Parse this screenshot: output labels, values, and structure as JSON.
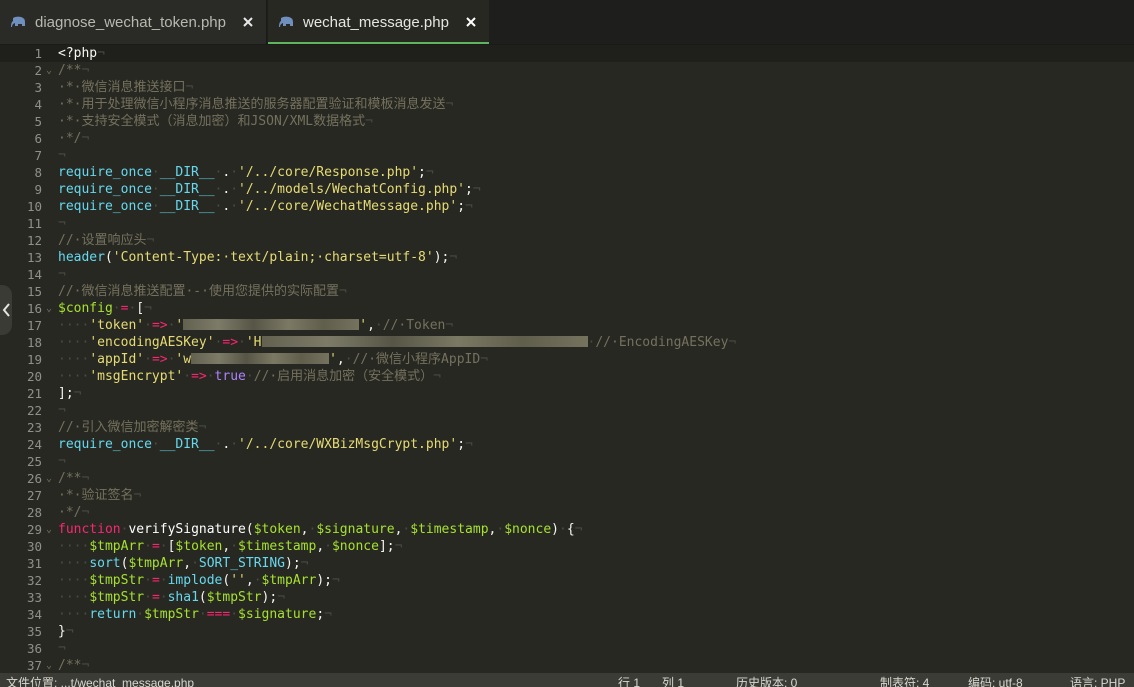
{
  "tabs": [
    {
      "label": "diagnose_wechat_token.php",
      "icon": "php-elephant-icon",
      "active": false
    },
    {
      "label": "wechat_message.php",
      "icon": "php-elephant-icon",
      "active": true
    }
  ],
  "editor": {
    "lines": [
      {
        "n": "1",
        "fold": "",
        "segs": [
          {
            "c": "tx",
            "t": "<?php"
          },
          {
            "c": "ws",
            "t": "¬"
          }
        ]
      },
      {
        "n": "2",
        "fold": "⌄",
        "segs": [
          {
            "c": "cm",
            "t": "/**"
          },
          {
            "c": "ws",
            "t": "¬"
          }
        ]
      },
      {
        "n": "3",
        "fold": "",
        "segs": [
          {
            "c": "cm",
            "t": "·*·微信消息推送接口"
          },
          {
            "c": "ws",
            "t": "¬"
          }
        ]
      },
      {
        "n": "4",
        "fold": "",
        "segs": [
          {
            "c": "cm",
            "t": "·*·用于处理微信小程序消息推送的服务器配置验证和模板消息发送"
          },
          {
            "c": "ws",
            "t": "¬"
          }
        ]
      },
      {
        "n": "5",
        "fold": "",
        "segs": [
          {
            "c": "cm",
            "t": "·*·支持安全模式（消息加密）和JSON/XML数据格式"
          },
          {
            "c": "ws",
            "t": "¬"
          }
        ]
      },
      {
        "n": "6",
        "fold": "",
        "segs": [
          {
            "c": "cm",
            "t": "·*/"
          },
          {
            "c": "ws",
            "t": "¬"
          }
        ]
      },
      {
        "n": "7",
        "fold": "",
        "segs": [
          {
            "c": "ws",
            "t": "¬"
          }
        ]
      },
      {
        "n": "8",
        "fold": "",
        "segs": [
          {
            "c": "kw",
            "t": "require_once"
          },
          {
            "c": "ws",
            "t": "·"
          },
          {
            "c": "kw",
            "t": "__DIR__"
          },
          {
            "c": "ws",
            "t": "·"
          },
          {
            "c": "tx",
            "t": "."
          },
          {
            "c": "ws",
            "t": "·"
          },
          {
            "c": "st",
            "t": "'/../core/Response.php'"
          },
          {
            "c": "tx",
            "t": ";"
          },
          {
            "c": "ws",
            "t": "¬"
          }
        ]
      },
      {
        "n": "9",
        "fold": "",
        "segs": [
          {
            "c": "kw",
            "t": "require_once"
          },
          {
            "c": "ws",
            "t": "·"
          },
          {
            "c": "kw",
            "t": "__DIR__"
          },
          {
            "c": "ws",
            "t": "·"
          },
          {
            "c": "tx",
            "t": "."
          },
          {
            "c": "ws",
            "t": "·"
          },
          {
            "c": "st",
            "t": "'/../models/WechatConfig.php'"
          },
          {
            "c": "tx",
            "t": ";"
          },
          {
            "c": "ws",
            "t": "¬"
          }
        ]
      },
      {
        "n": "10",
        "fold": "",
        "segs": [
          {
            "c": "kw",
            "t": "require_once"
          },
          {
            "c": "ws",
            "t": "·"
          },
          {
            "c": "kw",
            "t": "__DIR__"
          },
          {
            "c": "ws",
            "t": "·"
          },
          {
            "c": "tx",
            "t": "."
          },
          {
            "c": "ws",
            "t": "·"
          },
          {
            "c": "st",
            "t": "'/../core/WechatMessage.php'"
          },
          {
            "c": "tx",
            "t": ";"
          },
          {
            "c": "ws",
            "t": "¬"
          }
        ]
      },
      {
        "n": "11",
        "fold": "",
        "segs": [
          {
            "c": "ws",
            "t": "¬"
          }
        ]
      },
      {
        "n": "12",
        "fold": "",
        "segs": [
          {
            "c": "cm",
            "t": "//·设置响应头"
          },
          {
            "c": "ws",
            "t": "¬"
          }
        ]
      },
      {
        "n": "13",
        "fold": "",
        "segs": [
          {
            "c": "fn",
            "t": "header"
          },
          {
            "c": "tx",
            "t": "("
          },
          {
            "c": "st",
            "t": "'Content-Type:·text/plain;·charset=utf-8'"
          },
          {
            "c": "tx",
            "t": ");"
          },
          {
            "c": "ws",
            "t": "¬"
          }
        ]
      },
      {
        "n": "14",
        "fold": "",
        "segs": [
          {
            "c": "ws",
            "t": "¬"
          }
        ]
      },
      {
        "n": "15",
        "fold": "",
        "segs": [
          {
            "c": "cm",
            "t": "//·微信消息推送配置·-·使用您提供的实际配置"
          },
          {
            "c": "ws",
            "t": "¬"
          }
        ]
      },
      {
        "n": "16",
        "fold": "⌄",
        "segs": [
          {
            "c": "var",
            "t": "$config"
          },
          {
            "c": "ws",
            "t": "·"
          },
          {
            "c": "kw2",
            "t": "="
          },
          {
            "c": "ws",
            "t": "·"
          },
          {
            "c": "tx",
            "t": "["
          },
          {
            "c": "ws",
            "t": "¬"
          }
        ]
      },
      {
        "n": "17",
        "fold": "",
        "segs": [
          {
            "c": "ws",
            "t": "····"
          },
          {
            "c": "st",
            "t": "'token'"
          },
          {
            "c": "ws",
            "t": "·"
          },
          {
            "c": "kw2",
            "t": "=>"
          },
          {
            "c": "ws",
            "t": "·"
          },
          {
            "c": "st",
            "t": "'"
          },
          {
            "c": "blur",
            "w": 176
          },
          {
            "c": "st",
            "t": "'"
          },
          {
            "c": "tx",
            "t": ","
          },
          {
            "c": "ws",
            "t": "·"
          },
          {
            "c": "cm",
            "t": "//·Token"
          },
          {
            "c": "ws",
            "t": "¬"
          }
        ]
      },
      {
        "n": "18",
        "fold": "",
        "segs": [
          {
            "c": "ws",
            "t": "····"
          },
          {
            "c": "st",
            "t": "'encodingAESKey'"
          },
          {
            "c": "ws",
            "t": "·"
          },
          {
            "c": "kw2",
            "t": "=>"
          },
          {
            "c": "ws",
            "t": "·"
          },
          {
            "c": "st",
            "t": "'H"
          },
          {
            "c": "blur",
            "w": 326
          },
          {
            "c": "ws",
            "t": "·"
          },
          {
            "c": "cm",
            "t": "//·EncodingAESKey"
          },
          {
            "c": "ws",
            "t": "¬"
          }
        ]
      },
      {
        "n": "19",
        "fold": "",
        "segs": [
          {
            "c": "ws",
            "t": "····"
          },
          {
            "c": "st",
            "t": "'appId'"
          },
          {
            "c": "ws",
            "t": "·"
          },
          {
            "c": "kw2",
            "t": "=>"
          },
          {
            "c": "ws",
            "t": "·"
          },
          {
            "c": "st",
            "t": "'w"
          },
          {
            "c": "blur",
            "w": 138
          },
          {
            "c": "st",
            "t": "'"
          },
          {
            "c": "tx",
            "t": ","
          },
          {
            "c": "ws",
            "t": "·"
          },
          {
            "c": "cm",
            "t": "//·微信小程序AppID"
          },
          {
            "c": "ws",
            "t": "¬"
          }
        ]
      },
      {
        "n": "20",
        "fold": "",
        "segs": [
          {
            "c": "ws",
            "t": "····"
          },
          {
            "c": "st",
            "t": "'msgEncrypt'"
          },
          {
            "c": "ws",
            "t": "·"
          },
          {
            "c": "kw2",
            "t": "=>"
          },
          {
            "c": "ws",
            "t": "·"
          },
          {
            "c": "bo",
            "t": "true"
          },
          {
            "c": "ws",
            "t": "·"
          },
          {
            "c": "cm",
            "t": "//·启用消息加密（安全模式）"
          },
          {
            "c": "ws",
            "t": "¬"
          }
        ]
      },
      {
        "n": "21",
        "fold": "",
        "segs": [
          {
            "c": "tx",
            "t": "];"
          },
          {
            "c": "ws",
            "t": "¬"
          }
        ]
      },
      {
        "n": "22",
        "fold": "",
        "segs": [
          {
            "c": "ws",
            "t": "¬"
          }
        ]
      },
      {
        "n": "23",
        "fold": "",
        "segs": [
          {
            "c": "cm",
            "t": "//·引入微信加密解密类"
          },
          {
            "c": "ws",
            "t": "¬"
          }
        ]
      },
      {
        "n": "24",
        "fold": "",
        "segs": [
          {
            "c": "kw",
            "t": "require_once"
          },
          {
            "c": "ws",
            "t": "·"
          },
          {
            "c": "kw",
            "t": "__DIR__"
          },
          {
            "c": "ws",
            "t": "·"
          },
          {
            "c": "tx",
            "t": "."
          },
          {
            "c": "ws",
            "t": "·"
          },
          {
            "c": "st",
            "t": "'/../core/WXBizMsgCrypt.php'"
          },
          {
            "c": "tx",
            "t": ";"
          },
          {
            "c": "ws",
            "t": "¬"
          }
        ]
      },
      {
        "n": "25",
        "fold": "",
        "segs": [
          {
            "c": "ws",
            "t": "¬"
          }
        ]
      },
      {
        "n": "26",
        "fold": "⌄",
        "segs": [
          {
            "c": "cm",
            "t": "/**"
          },
          {
            "c": "ws",
            "t": "¬"
          }
        ]
      },
      {
        "n": "27",
        "fold": "",
        "segs": [
          {
            "c": "cm",
            "t": "·*·验证签名"
          },
          {
            "c": "ws",
            "t": "¬"
          }
        ]
      },
      {
        "n": "28",
        "fold": "",
        "segs": [
          {
            "c": "cm",
            "t": "·*/"
          },
          {
            "c": "ws",
            "t": "¬"
          }
        ]
      },
      {
        "n": "29",
        "fold": "⌄",
        "segs": [
          {
            "c": "kw2",
            "t": "function"
          },
          {
            "c": "ws",
            "t": "·"
          },
          {
            "c": "wt",
            "t": "verifySignature"
          },
          {
            "c": "tx",
            "t": "("
          },
          {
            "c": "var",
            "t": "$token"
          },
          {
            "c": "tx",
            "t": ","
          },
          {
            "c": "ws",
            "t": "·"
          },
          {
            "c": "var",
            "t": "$signature"
          },
          {
            "c": "tx",
            "t": ","
          },
          {
            "c": "ws",
            "t": "·"
          },
          {
            "c": "var",
            "t": "$timestamp"
          },
          {
            "c": "tx",
            "t": ","
          },
          {
            "c": "ws",
            "t": "·"
          },
          {
            "c": "var",
            "t": "$nonce"
          },
          {
            "c": "tx",
            "t": ")"
          },
          {
            "c": "ws",
            "t": "·"
          },
          {
            "c": "tx",
            "t": "{"
          },
          {
            "c": "ws",
            "t": "¬"
          }
        ]
      },
      {
        "n": "30",
        "fold": "",
        "segs": [
          {
            "c": "ws",
            "t": "····"
          },
          {
            "c": "var",
            "t": "$tmpArr"
          },
          {
            "c": "ws",
            "t": "·"
          },
          {
            "c": "kw2",
            "t": "="
          },
          {
            "c": "ws",
            "t": "·"
          },
          {
            "c": "tx",
            "t": "["
          },
          {
            "c": "var",
            "t": "$token"
          },
          {
            "c": "tx",
            "t": ","
          },
          {
            "c": "ws",
            "t": "·"
          },
          {
            "c": "var",
            "t": "$timestamp"
          },
          {
            "c": "tx",
            "t": ","
          },
          {
            "c": "ws",
            "t": "·"
          },
          {
            "c": "var",
            "t": "$nonce"
          },
          {
            "c": "tx",
            "t": "];"
          },
          {
            "c": "ws",
            "t": "¬"
          }
        ]
      },
      {
        "n": "31",
        "fold": "",
        "segs": [
          {
            "c": "ws",
            "t": "····"
          },
          {
            "c": "fn",
            "t": "sort"
          },
          {
            "c": "tx",
            "t": "("
          },
          {
            "c": "var",
            "t": "$tmpArr"
          },
          {
            "c": "tx",
            "t": ","
          },
          {
            "c": "ws",
            "t": "·"
          },
          {
            "c": "kw",
            "t": "SORT_STRING"
          },
          {
            "c": "tx",
            "t": ");"
          },
          {
            "c": "ws",
            "t": "¬"
          }
        ]
      },
      {
        "n": "32",
        "fold": "",
        "segs": [
          {
            "c": "ws",
            "t": "····"
          },
          {
            "c": "var",
            "t": "$tmpStr"
          },
          {
            "c": "ws",
            "t": "·"
          },
          {
            "c": "kw2",
            "t": "="
          },
          {
            "c": "ws",
            "t": "·"
          },
          {
            "c": "fn",
            "t": "implode"
          },
          {
            "c": "tx",
            "t": "("
          },
          {
            "c": "st",
            "t": "''"
          },
          {
            "c": "tx",
            "t": ","
          },
          {
            "c": "ws",
            "t": "·"
          },
          {
            "c": "var",
            "t": "$tmpArr"
          },
          {
            "c": "tx",
            "t": ");"
          },
          {
            "c": "ws",
            "t": "¬"
          }
        ]
      },
      {
        "n": "33",
        "fold": "",
        "segs": [
          {
            "c": "ws",
            "t": "····"
          },
          {
            "c": "var",
            "t": "$tmpStr"
          },
          {
            "c": "ws",
            "t": "·"
          },
          {
            "c": "kw2",
            "t": "="
          },
          {
            "c": "ws",
            "t": "·"
          },
          {
            "c": "fn",
            "t": "sha1"
          },
          {
            "c": "tx",
            "t": "("
          },
          {
            "c": "var",
            "t": "$tmpStr"
          },
          {
            "c": "tx",
            "t": ");"
          },
          {
            "c": "ws",
            "t": "¬"
          }
        ]
      },
      {
        "n": "34",
        "fold": "",
        "segs": [
          {
            "c": "ws",
            "t": "····"
          },
          {
            "c": "kw",
            "t": "return"
          },
          {
            "c": "ws",
            "t": "·"
          },
          {
            "c": "var",
            "t": "$tmpStr"
          },
          {
            "c": "ws",
            "t": "·"
          },
          {
            "c": "kw2",
            "t": "==="
          },
          {
            "c": "ws",
            "t": "·"
          },
          {
            "c": "var",
            "t": "$signature"
          },
          {
            "c": "tx",
            "t": ";"
          },
          {
            "c": "ws",
            "t": "¬"
          }
        ]
      },
      {
        "n": "35",
        "fold": "",
        "segs": [
          {
            "c": "tx",
            "t": "}"
          },
          {
            "c": "ws",
            "t": "¬"
          }
        ]
      },
      {
        "n": "36",
        "fold": "",
        "segs": [
          {
            "c": "ws",
            "t": "¬"
          }
        ]
      },
      {
        "n": "37",
        "fold": "⌄",
        "segs": [
          {
            "c": "cm",
            "t": "/**"
          },
          {
            "c": "ws",
            "t": "¬"
          }
        ]
      }
    ],
    "current_line_index": 0
  },
  "statusbar": {
    "left": "文件位置: ...t/wechat_message.php",
    "items": [
      "行 1",
      "列 1",
      "历史版本: 0",
      "制表符: 4",
      "编码: utf-8",
      "语言: PHP"
    ]
  },
  "colors": {
    "background": "#272822",
    "tab_active_underline": "#5fb55f",
    "string": "#e6db74",
    "keyword": "#66d9ef",
    "operator": "#f92672",
    "variable": "#a6e22e",
    "comment": "#75715e"
  }
}
